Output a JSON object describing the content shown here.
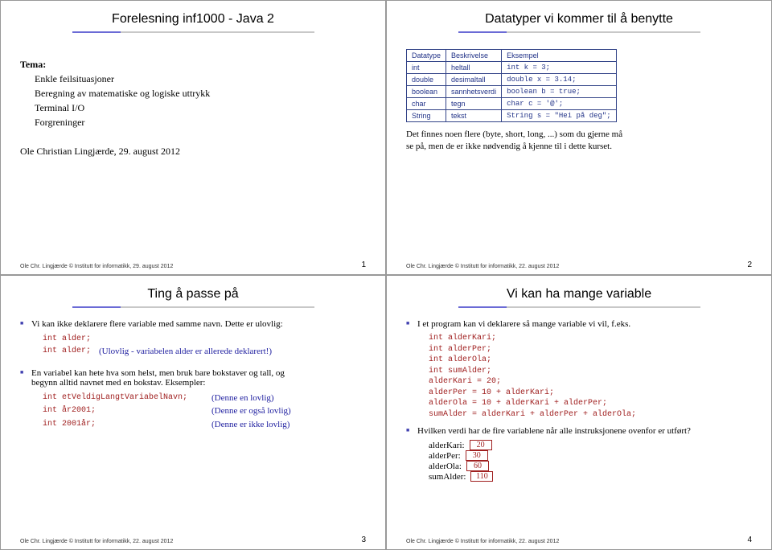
{
  "slide1": {
    "title": "Forelesning inf1000 - Java 2",
    "tema_label": "Tema:",
    "tema1": "Enkle feilsituasjoner",
    "tema2": "Beregning av matematiske og logiske uttrykk",
    "tema3": "Terminal I/O",
    "tema4": "Forgreninger",
    "author": "Ole Christian Lingjærde, 29. august 2012",
    "footer": "Ole Chr. Lingjærde © Institutt for informatikk, 29. august 2012",
    "page": "1"
  },
  "slide2": {
    "title": "Datatyper vi kommer til å benytte",
    "th1": "Datatype",
    "th2": "Beskrivelse",
    "th3": "Eksempel",
    "r1a": "int",
    "r1b": "heltall",
    "r1c": "int k = 3;",
    "r2a": "double",
    "r2b": "desimaltall",
    "r2c": "double x = 3.14;",
    "r3a": "boolean",
    "r3b": "sannhetsverdi",
    "r3c": "boolean b = true;",
    "r4a": "char",
    "r4b": "tegn",
    "r4c": "char c = '@';",
    "r5a": "String",
    "r5b": "tekst",
    "r5c": "String s = \"Hei på deg\";",
    "note1": "Det finnes noen flere (byte, short, long, ...) som du gjerne må",
    "note2": "se på, men de er ikke nødvendig å kjenne til i dette kurset.",
    "footer": "Ole Chr. Lingjærde © Institutt for informatikk, 22. august 2012",
    "page": "2"
  },
  "slide3": {
    "title": "Ting å passe på",
    "b1": "Vi kan ikke deklarere flere variable med samme navn. Dette er ulovlig:",
    "c1a": "int alder;",
    "c1b": "int alder;",
    "c1b_note": "(Ulovlig - variabelen alder er allerede deklarert!)",
    "b2a": "En variabel kan hete hva som helst, men bruk bare bokstaver og tall, og",
    "b2b": "begynn alltid navnet med en bokstav. Eksempler:",
    "c2a": "int etVeldigLangtVariabelNavn;",
    "c2a_note": "(Denne en lovlig)",
    "c2b": "int år2001;",
    "c2b_note": "(Denne er også lovlig)",
    "c2c": "int 2001år;",
    "c2c_note": "(Denne er ikke lovlig)",
    "footer": "Ole Chr. Lingjærde © Institutt for informatikk, 22. august 2012",
    "page": "3"
  },
  "slide4": {
    "title": "Vi kan ha mange variable",
    "b1": "I et program kan vi deklarere så mange variable vi vil, f.eks.",
    "c1": "int alderKari;",
    "c2": "int alderPer;",
    "c3": "int alderOla;",
    "c4": "int sumAlder;",
    "c5": "alderKari = 20;",
    "c6": "alderPer = 10 + alderKari;",
    "c7": "alderOla = 10 + alderKari + alderPer;",
    "c8": "sumAlder = alderKari + alderPer + alderOla;",
    "b2": "Hvilken verdi har de fire variablene når alle instruksjonene ovenfor er utført?",
    "k1": "alderKari:",
    "v1": "20",
    "k2": "alderPer:",
    "v2": "30",
    "k3": "alderOla:",
    "v3": "60",
    "k4": "sumAlder:",
    "v4": "110",
    "footer": "Ole Chr. Lingjærde © Institutt for informatikk, 22. august 2012",
    "page": "4"
  }
}
